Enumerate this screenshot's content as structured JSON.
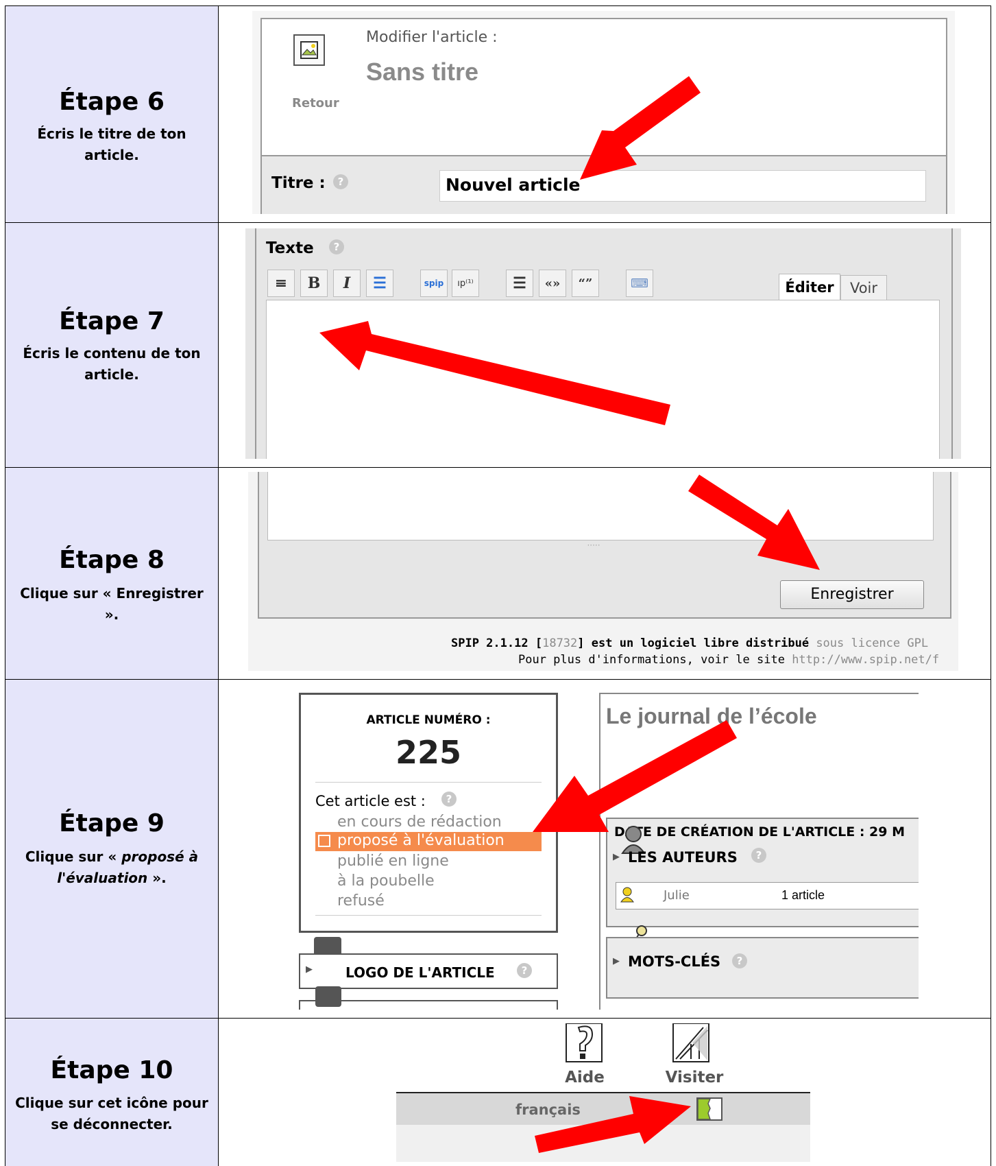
{
  "steps": [
    {
      "title": "Étape 6",
      "desc": "Écris le titre de ton article."
    },
    {
      "title": "Étape 7",
      "desc": "Écris le contenu de ton article."
    },
    {
      "title": "Étape 8",
      "desc": "Clique sur « Enregistrer »."
    },
    {
      "title": "Étape 9",
      "desc_prefix": "Clique sur « ",
      "desc_em": "proposé à l'évaluation",
      "desc_suffix": " »."
    },
    {
      "title": "Étape 10",
      "desc": "Clique sur cet icône pour se déconnecter."
    }
  ],
  "step6": {
    "modify_label": "Modifier l'article :",
    "article_heading": "Sans titre",
    "back_label": "Retour",
    "title_label": "Titre :",
    "title_value": "Nouvel article"
  },
  "step7": {
    "text_label": "Texte",
    "tab_edit": "Éditer",
    "tab_view": "Voir",
    "toolbar_icons": [
      "align-icon",
      "bold-icon",
      "italic-icon",
      "list-icon",
      "spip-link-icon",
      "note-icon",
      "paragraph-icon",
      "french-quotes-icon",
      "english-quotes-icon",
      "keyboard-icon"
    ]
  },
  "step8": {
    "save_label": "Enregistrer",
    "footer_spip": "SPIP 2.1.12",
    "footer_rev_open": "[",
    "footer_rev": "18732",
    "footer_rev_close": "]",
    "footer_text": "est un logiciel libre distribué",
    "footer_licence": "sous licence GPL",
    "footer_line2": "Pour plus d'informations, voir le site",
    "footer_url": "http://www.spip.net/f"
  },
  "step9": {
    "article_number_label": "ARTICLE NUMÉRO :",
    "article_number": "225",
    "status_label": "Cet article est :",
    "statuses": [
      "en cours de rédaction",
      "proposé à l'évaluation",
      "publié en ligne",
      "à la poubelle",
      "refusé"
    ],
    "logo_label": "LOGO DE L'ARTICLE",
    "journal_title": "Le journal de l’école",
    "creation_date_label": "DATE DE CRÉATION DE L'ARTICLE : 29 M",
    "authors_label": "LES AUTEURS",
    "author_name": "Julie",
    "author_count": "1 article",
    "keywords_label": "MOTS-CLÉS"
  },
  "step10": {
    "help_label": "Aide",
    "visit_label": "Visiter",
    "language_label": "français"
  },
  "colors": {
    "left_bg": "#e5e5fa",
    "arrow": "#ff0000",
    "selected_status": "#f58b4c"
  }
}
